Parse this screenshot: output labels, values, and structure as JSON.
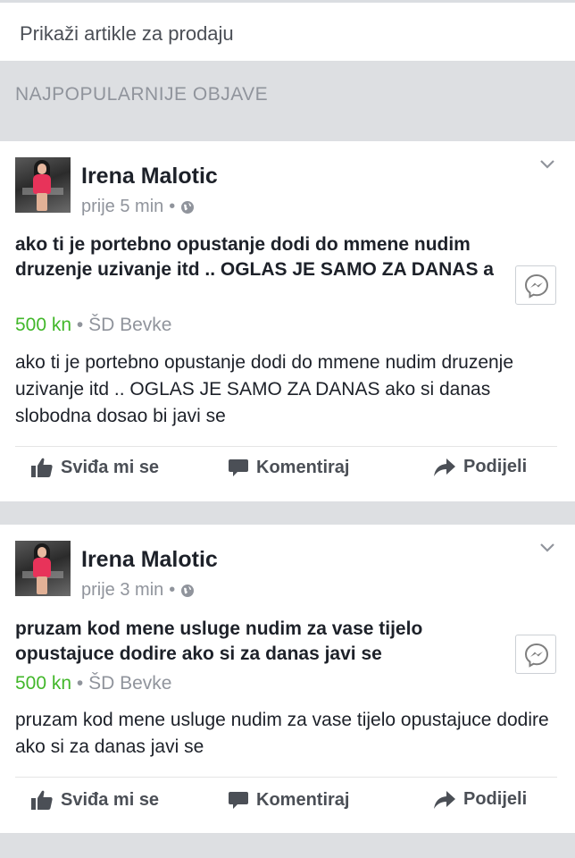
{
  "top": {
    "link": "Prikaži artikle za prodaju"
  },
  "section": {
    "title": "NAJPOPULARNIJE OBJAVE"
  },
  "colors": {
    "price": "#42b72a",
    "meta": "#90949c",
    "section_bg": "#dddfe2"
  },
  "posts": [
    {
      "author": "Irena Malotic",
      "time": "prije 5 min",
      "separator": "•",
      "title": "ako ti je portebno opustanje dodi do mmene nudim druzenje uzivanje itd ..  OGLAS JE SAMO ZA DANAS  a",
      "price": "500 kn",
      "location": "• ŠD Bevke",
      "body": "ako ti je portebno opustanje dodi do mmene nudim druzenje uzivanje itd ..  OGLAS JE SAMO ZA DANAS  ako si danas slobodna dosao bi javi se"
    },
    {
      "author": "Irena Malotic",
      "time": "prije 3 min",
      "separator": "•",
      "title": "pruzam kod mene usluge  nudim za vase tijelo opustajuce dodire ako si za danas javi se",
      "price": "500 kn",
      "location": "• ŠD Bevke",
      "body": "pruzam kod mene usluge  nudim za vase tijelo opustajuce dodire ako si za danas javi se"
    }
  ],
  "actions": {
    "like": "Sviđa mi se",
    "comment": "Komentiraj",
    "share": "Podijeli"
  },
  "icons": [
    "globe-icon",
    "chevron-down-icon",
    "messenger-icon",
    "like-icon",
    "comment-icon",
    "share-icon"
  ]
}
